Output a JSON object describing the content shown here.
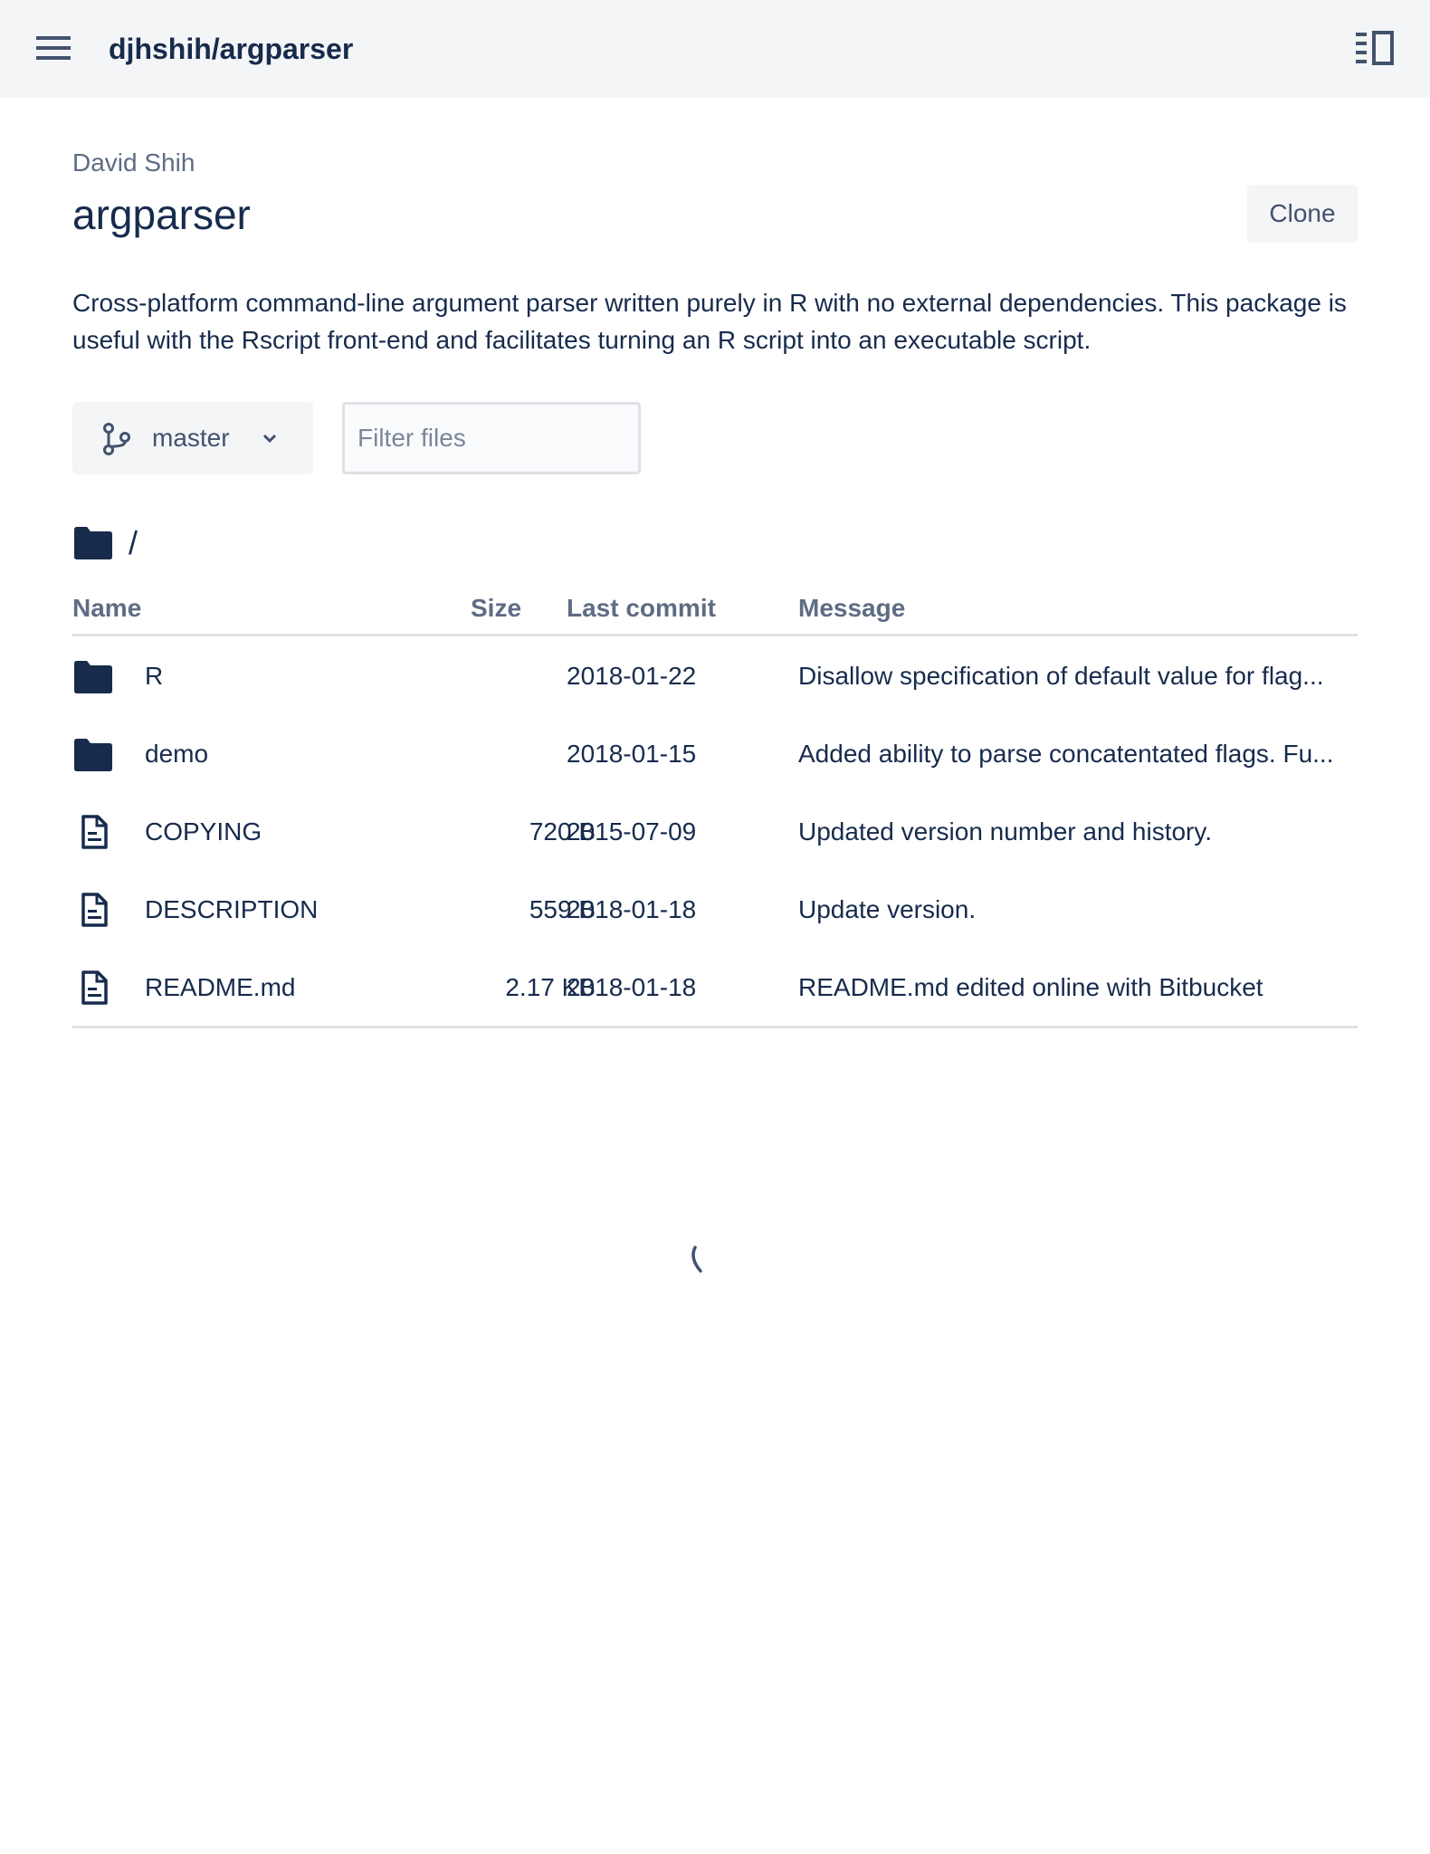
{
  "header": {
    "repo_path": "djhshih/argparser",
    "menu_icon": "hamburger-menu-icon",
    "sidebar_icon": "sidebar-toggle-icon",
    "background": "#f4f5f7"
  },
  "repo": {
    "owner": "David Shih",
    "name": "argparser",
    "clone_label": "Clone",
    "description": "Cross-platform command-line argument parser written purely in R with no external dependencies. This package is useful with the Rscript front-end and facilitates turning an R script into an executable script."
  },
  "branch": {
    "label": "master",
    "icon": "branch-icon"
  },
  "filter": {
    "placeholder": "Filter files",
    "value": ""
  },
  "breadcrumb": {
    "path": "/",
    "icon": "folder-icon"
  },
  "table": {
    "columns": {
      "name": "Name",
      "size": "Size",
      "last_commit": "Last commit",
      "message": "Message"
    },
    "rows": [
      {
        "type": "folder",
        "name": "R",
        "size": "",
        "date": "2018-01-22",
        "message": "Disallow specification of default value for flag..."
      },
      {
        "type": "folder",
        "name": "demo",
        "size": "",
        "date": "2018-01-15",
        "message": "Added ability to parse concatentated flags. Fu..."
      },
      {
        "type": "file",
        "name": "COPYING",
        "size": "720 B",
        "date": "2015-07-09",
        "message": "Updated version number and history."
      },
      {
        "type": "file",
        "name": "DESCRIPTION",
        "size": "559 B",
        "date": "2018-01-18",
        "message": "Update version."
      },
      {
        "type": "file",
        "name": "README.md",
        "size": "2.17 KB",
        "date": "2018-01-18",
        "message": "README.md edited online with Bitbucket"
      }
    ]
  },
  "colors": {
    "text": "#172b4d",
    "muted": "#5e6c84",
    "rule": "#dfe1e6",
    "button_bg": "#f4f5f7"
  }
}
